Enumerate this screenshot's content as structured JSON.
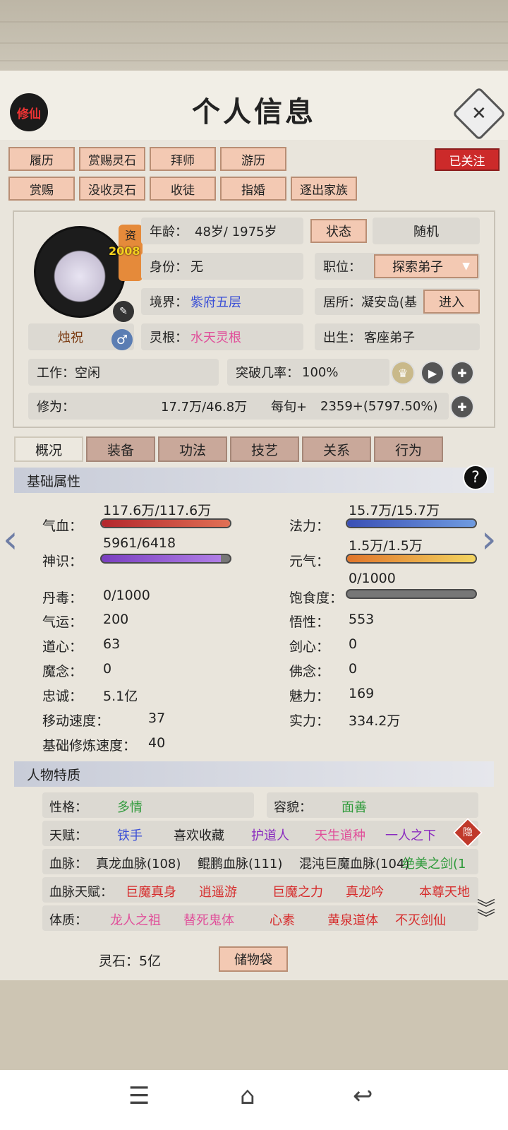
{
  "header": {
    "logo": "修仙",
    "title": "个人信息",
    "close_icon": "close-icon"
  },
  "actions": {
    "row1": [
      "履历",
      "赏赐灵石",
      "拜师",
      "游历"
    ],
    "row2": [
      "赏赐",
      "没收灵石",
      "收徒",
      "指婚",
      "逐出家族"
    ],
    "follow": "已关注"
  },
  "profile": {
    "zi_label": "资",
    "zi_value": "2008",
    "name": "烛祝",
    "age_label": "年龄：",
    "age_value": "48岁/ 1975岁",
    "status_btn": "状态",
    "random_btn": "随机",
    "identity_label": "身份：",
    "identity_value": "无",
    "position_label": "职位：",
    "position_value": "探索弟子",
    "realm_label": "境界：",
    "realm_value": "紫府五层",
    "residence_label": "居所：",
    "residence_value": "凝安岛(基",
    "enter_btn": "进入",
    "root_label": "灵根：",
    "root_value": "水天灵根",
    "birth_label": "出生：",
    "birth_value": "客座弟子",
    "work_label": "工作：",
    "work_value": "空闲",
    "breakthrough_label": "突破几率：",
    "breakthrough_value": "100%",
    "cultivation_label": "修为：",
    "cultivation_value": "17.7万/46.8万",
    "per_label": "每旬+",
    "per_value": "2359+(5797.50%)"
  },
  "tabs": [
    "概况",
    "装备",
    "功法",
    "技艺",
    "关系",
    "行为"
  ],
  "basic": {
    "title": "基础属性",
    "qixue_label": "气血：",
    "qixue_value": "117.6万/117.6万",
    "qixue_fill": 1.0,
    "fali_label": "法力：",
    "fali_value": "15.7万/15.7万",
    "fali_fill": 1.0,
    "shenshi_label": "神识：",
    "shenshi_value": "5961/6418",
    "shenshi_fill": 0.93,
    "yuanqi_label": "元气：",
    "yuanqi_value": "1.5万/1.5万",
    "yuanqi_fill": 1.0,
    "baoshi_label": "饱食度：",
    "baoshi_value": "0/1000",
    "baoshi_fill": 0.0,
    "stats_left": [
      [
        "丹毒：",
        "0/1000"
      ],
      [
        "气运：",
        "200"
      ],
      [
        "道心：",
        "63"
      ],
      [
        "魔念：",
        "0"
      ],
      [
        "忠诚：",
        "5.1亿"
      ],
      [
        "移动速度：",
        "37"
      ],
      [
        "基础修炼速度：",
        "40"
      ]
    ],
    "stats_right": [
      [
        "悟性：",
        "553"
      ],
      [
        "剑心：",
        "0"
      ],
      [
        "佛念：",
        "0"
      ],
      [
        "魅力：",
        "169"
      ],
      [
        "实力：",
        "334.2万"
      ]
    ]
  },
  "traits": {
    "title": "人物特质",
    "personality_label": "性格：",
    "personality_value": "多情",
    "looks_label": "容貌：",
    "looks_value": "面善",
    "talent_label": "天赋：",
    "talents": [
      "铁手",
      "喜欢收藏",
      "护道人",
      "天生道种",
      "一人之下"
    ],
    "hide_badge": "隐",
    "blood_label": "血脉：",
    "bloods": [
      "真龙血脉(108)",
      "鲲鹏血脉(111)",
      "混沌巨魔血脉(104)",
      "绝美之剑(1"
    ],
    "blood_talent_label": "血脉天赋：",
    "blood_talents": [
      "巨魔真身",
      "逍遥游",
      "巨魔之力",
      "真龙吟",
      "本尊天地"
    ],
    "physique_label": "体质：",
    "physiques": [
      "龙人之祖",
      "替死鬼体",
      "心素",
      "黄泉道体",
      "不灭剑仙"
    ]
  },
  "footer": {
    "stone_label": "灵石：5亿",
    "bag_btn": "储物袋"
  },
  "colors": {
    "accent_btn": "#f3c9b3",
    "follow_red": "#cc2a2a",
    "realm_blue": "#3a4fd6",
    "root_pink": "#e0509a",
    "green": "#2e9a3a",
    "red": "#d62b2b",
    "purple": "#8a2bbf"
  }
}
